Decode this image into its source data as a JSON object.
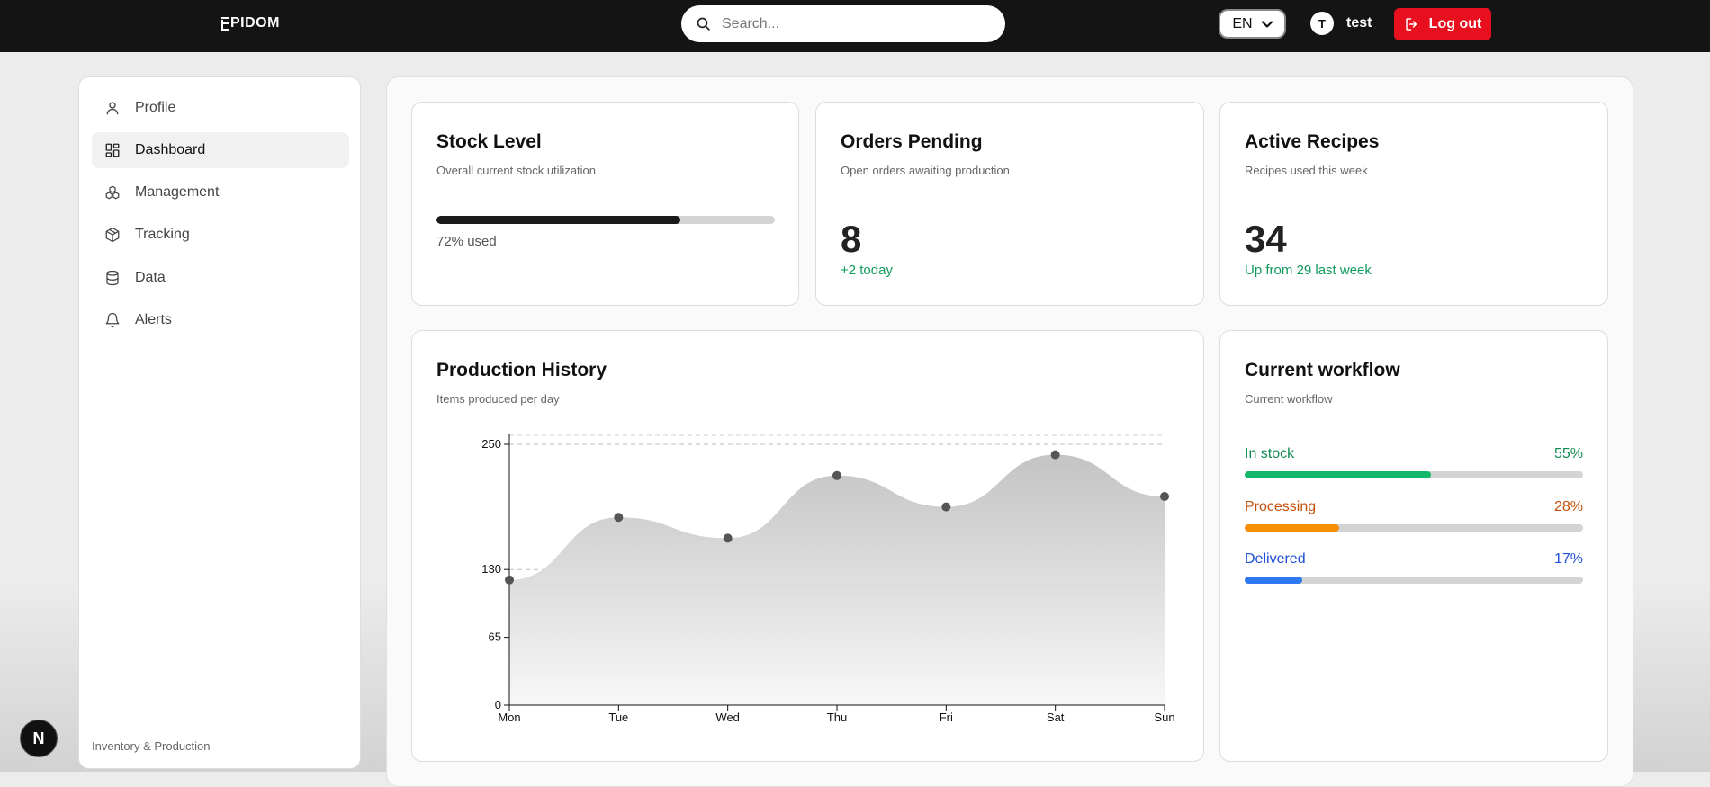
{
  "app": {
    "logo_text": "PIDOM"
  },
  "search": {
    "placeholder": "Search..."
  },
  "language": {
    "selected": "EN"
  },
  "user": {
    "initial": "T",
    "name": "test"
  },
  "header": {
    "logout_label": "Log out"
  },
  "sidebar": {
    "items": [
      {
        "label": "Profile",
        "icon": "user-icon"
      },
      {
        "label": "Dashboard",
        "icon": "dashboard-icon",
        "active": true
      },
      {
        "label": "Management",
        "icon": "boxes-icon"
      },
      {
        "label": "Tracking",
        "icon": "package-icon"
      },
      {
        "label": "Data",
        "icon": "database-icon"
      },
      {
        "label": "Alerts",
        "icon": "bell-icon"
      }
    ],
    "footer": "Inventory & Production"
  },
  "nextjs_badge": "N",
  "cards": {
    "stock": {
      "title": "Stock Level",
      "subtitle": "Overall current stock utilization",
      "percent": 72,
      "note": "72% used"
    },
    "orders": {
      "title": "Orders Pending",
      "subtitle": "Open orders awaiting production",
      "value": "8",
      "note": "+2 today"
    },
    "recipes": {
      "title": "Active Recipes",
      "subtitle": "Recipes used this week",
      "value": "34",
      "note": "Up from 29 last week"
    },
    "production": {
      "title": "Production History",
      "subtitle": "Items produced per day"
    },
    "workflow": {
      "title": "Current workflow",
      "subtitle": "Current workflow",
      "items": [
        {
          "label": "In stock",
          "value": "55%",
          "percent": 55,
          "color": "#12b76a",
          "text_color": "#0f8a50"
        },
        {
          "label": "Processing",
          "value": "28%",
          "percent": 28,
          "color": "#f79009",
          "text_color": "#c4500a"
        },
        {
          "label": "Delivered",
          "value": "17%",
          "percent": 17,
          "color": "#2e78f0",
          "text_color": "#1d4ed8"
        }
      ]
    }
  },
  "chart_data": {
    "type": "area",
    "categories": [
      "Mon",
      "Tue",
      "Wed",
      "Thu",
      "Fri",
      "Sat",
      "Sun"
    ],
    "series": [
      {
        "values": [
          120,
          180,
          160,
          220,
          190,
          240,
          200
        ]
      }
    ],
    "yticks": [
      0,
      65,
      130,
      250
    ],
    "ylim": [
      0,
      250
    ],
    "grid": true
  }
}
